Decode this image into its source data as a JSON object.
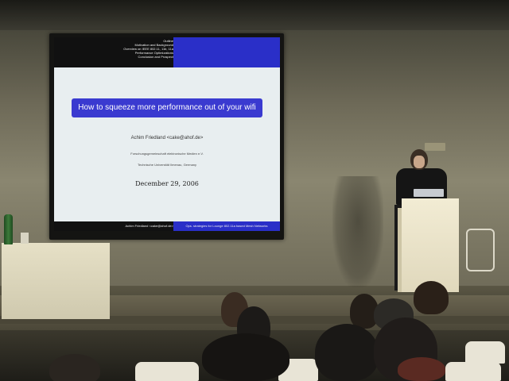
{
  "slide": {
    "nav_items": [
      "Outline",
      "Motivation and Background",
      "Overview on IEEE 802.11, 11b, 11a",
      "Performance Optimizations",
      "Conclusion and Prospect"
    ],
    "title": "How to squeeze more performance out of your wifi",
    "author": "Achim Friedland <cake@ahof.de>",
    "org1": "Forschungsgemeinschaft elektronische Medien e.V.",
    "org2": "Technische Universität Ilmenau, Germany",
    "date": "December 29, 2006",
    "footer_left": "Achim Friedland <cake@ahof.de>",
    "footer_right": "Ops. strategies for Lounge 802.11a based Mesh Networks"
  },
  "colors": {
    "slide_accent": "#2a2fc8",
    "slide_background": "#e8eef0",
    "podium": "#f2ecd4"
  }
}
